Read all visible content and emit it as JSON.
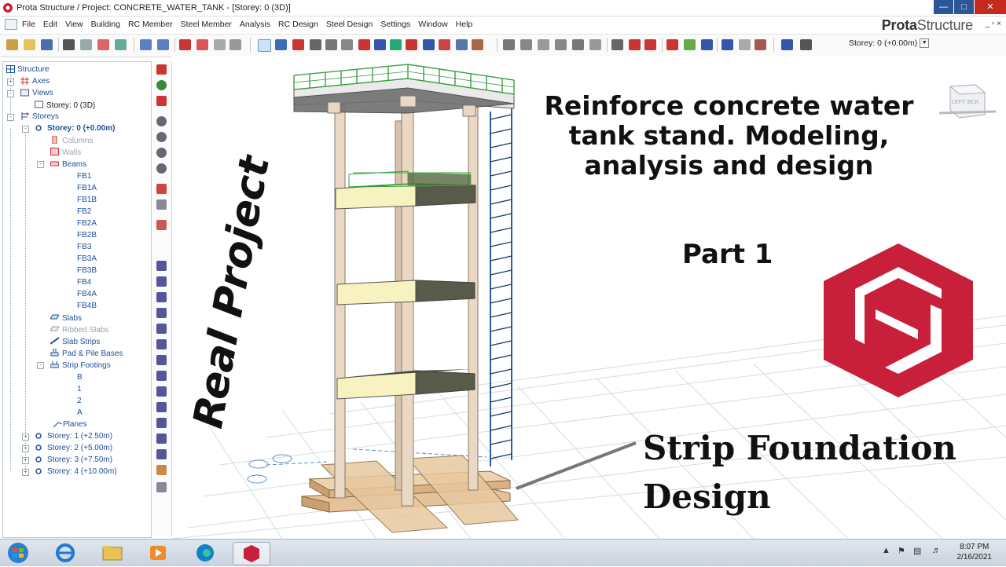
{
  "window": {
    "title": "Prota Structure / Project: CONCRETE_WATER_TANK - [Storey: 0 (3D)]",
    "brand_a": "Prota",
    "brand_b": "Structure",
    "brand_controls": "_ ▫ ×"
  },
  "menu": [
    "File",
    "Edit",
    "View",
    "Building",
    "RC Member",
    "Steel Member",
    "Analysis",
    "RC Design",
    "Steel Design",
    "Settings",
    "Window",
    "Help"
  ],
  "toolbar": {
    "storey_selector": "Storey: 0 (+0.00m)"
  },
  "tree": {
    "root": "Structure",
    "axes": "Axes",
    "views": "Views",
    "view_item": "Storey: 0 (3D)",
    "storeys": "Storeys",
    "storey0": "Storey: 0 (+0.00m)",
    "columns": "Columns",
    "walls": "Walls",
    "beams": "Beams",
    "beam_items": [
      "FB1",
      "FB1A",
      "FB1B",
      "FB2",
      "FB2A",
      "FB2B",
      "FB3",
      "FB3A",
      "FB3B",
      "FB4",
      "FB4A",
      "FB4B"
    ],
    "slabs": "Slabs",
    "ribbed_slabs": "Ribbed Slabs",
    "slab_strips": "Slab Strips",
    "pad_pile": "Pad & Pile Bases",
    "strip_footings": "Strip Footings",
    "footing_items": [
      "B",
      "1",
      "2",
      "A"
    ],
    "planes": "Planes",
    "other_storeys": [
      "Storey: 1 (+2.50m)",
      "Storey: 2 (+5.00m)",
      "Storey: 3 (+7.50m)",
      "Storey: 4 (+10.00m)"
    ]
  },
  "overlay": {
    "headline_lines": [
      "Reinforce concrete water",
      "tank stand.  Modeling,",
      "analysis and design"
    ],
    "part": "Part 1",
    "real_project": "Real Project",
    "strip_lines": [
      "Strip Foundation",
      "Design"
    ],
    "viewcube_labels": [
      "LEFT",
      "BCK"
    ]
  },
  "taskbar": {
    "time": "8:07 PM",
    "date": "2/16/2021"
  },
  "colors": {
    "logo_red": "#c8203a",
    "selection_blue": "#1d4e9a",
    "rail_green": "#3aa040",
    "ladder_blue": "#2b5fa8"
  }
}
